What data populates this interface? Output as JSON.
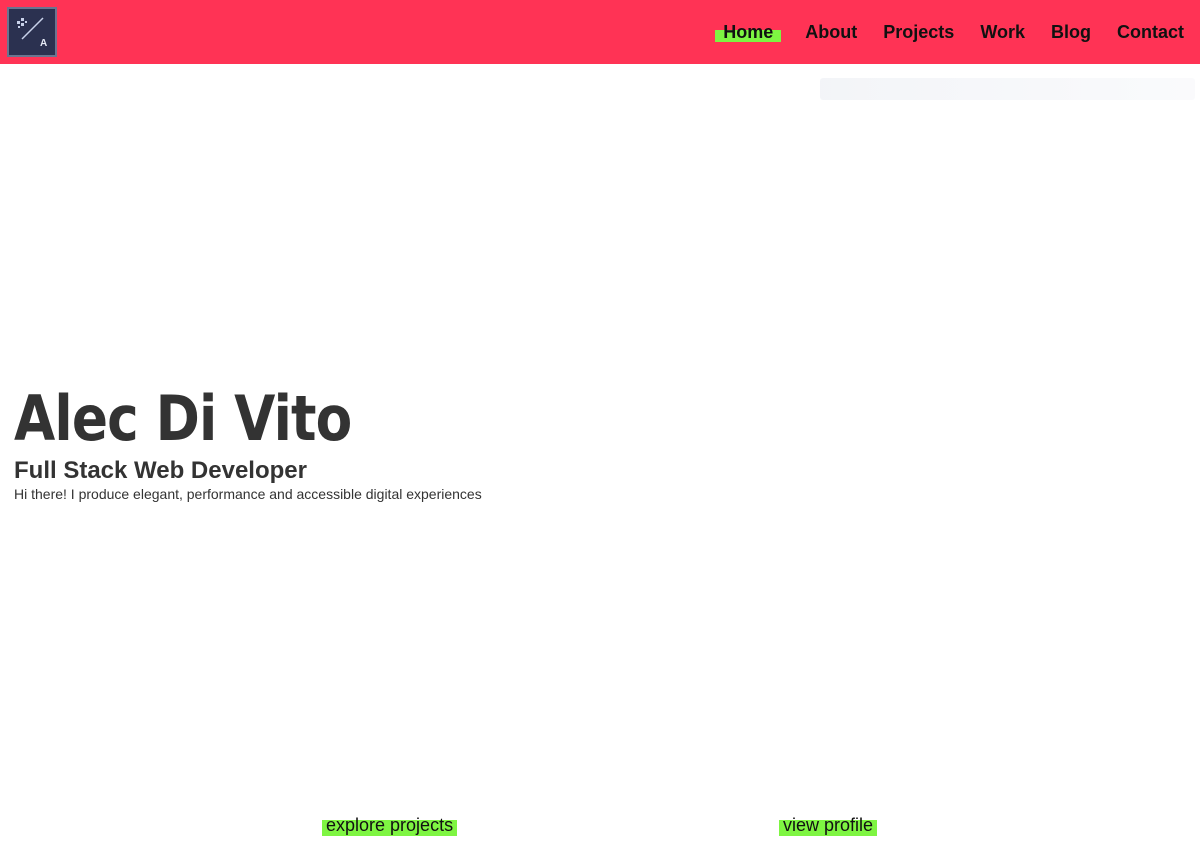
{
  "header": {
    "logo_icon": "site-monogram-logo",
    "logo_letter": "A",
    "nav": [
      {
        "label": "Home",
        "active": true
      },
      {
        "label": "About",
        "active": false
      },
      {
        "label": "Projects",
        "active": false
      },
      {
        "label": "Work",
        "active": false
      },
      {
        "label": "Blog",
        "active": false
      },
      {
        "label": "Contact",
        "active": false
      }
    ]
  },
  "hero": {
    "name": "Alec Di Vito",
    "role": "Full Stack Web Developer",
    "tagline": "Hi there! I produce elegant, performance and accessible digital experiences"
  },
  "cta": {
    "explore_label": "explore projects",
    "profile_label": "view profile"
  },
  "colors": {
    "navbar": "#ff3355",
    "highlight": "#7ef542",
    "text": "#333333",
    "logo_bg": "#2b3150"
  }
}
